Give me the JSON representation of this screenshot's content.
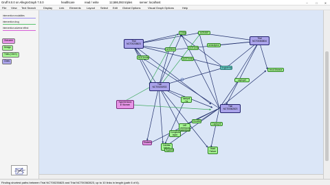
{
  "window": {
    "app_title": "Gruff 8.0.0 on AllegroGraph 7.0.0",
    "repo": "healthcare",
    "mode": "read / write",
    "triples": "12,586,093 triples",
    "server": "server: localhost"
  },
  "window_buttons": [
    "–",
    "□",
    "✕"
  ],
  "menu": [
    "File",
    "View",
    "Text Search",
    "Display",
    "Link",
    "Elements",
    "Layout",
    "Select",
    "Edit",
    "Global Options",
    "Visual Graph Options",
    "Help"
  ],
  "legend": {
    "lines": [
      {
        "label": "intervention modalities",
        "color": "#9b8ff0"
      },
      {
        "label": "intervention drug",
        "color": "#55c26b"
      },
      {
        "label": "intervention adverse effect",
        "color": "#d65bd6"
      }
    ],
    "chips": [
      {
        "label": "Outcome",
        "color": "#e794e7"
      },
      {
        "label": "Design",
        "color": "#a5f592"
      },
      {
        "label": "Trials (ClinG)",
        "color": "#a5f592"
      },
      {
        "label": "Class",
        "color": "#aaa3ea"
      }
    ]
  },
  "graph": {
    "nodes": [
      {
        "label": "Trial\nNCT00235823",
        "type": "purple"
      },
      {
        "label": "Trial\nNCT00363834",
        "type": "purple"
      },
      {
        "label": "Trial\nNCT00234933",
        "type": "purple"
      },
      {
        "label": "Trial\nNCT00362823",
        "type": "purple"
      },
      {
        "label": "C08A",
        "type": "green"
      },
      {
        "label": "ACEA5S",
        "type": "green"
      },
      {
        "label": "ACE5N1",
        "type": "green"
      },
      {
        "label": "ACE1nhib",
        "type": "green"
      },
      {
        "label": "amlodipine",
        "type": "green"
      },
      {
        "label": "Angiotensin",
        "type": "teal"
      },
      {
        "label": "ACE1Inhib",
        "type": "green"
      },
      {
        "label": "ACE7nhib",
        "type": "green"
      },
      {
        "label": "renal disease",
        "type": "green"
      },
      {
        "label": "captopril",
        "type": "green"
      },
      {
        "label": "ramipril / lis",
        "type": "green"
      },
      {
        "label": "Diuretic",
        "type": "green"
      },
      {
        "label": "Left\nventricular\nhypertrophy",
        "type": "green"
      },
      {
        "label": "Captopril",
        "type": "green"
      },
      {
        "label": "Heart\nFailure",
        "type": "green"
      },
      {
        "label": "Cardiac\nfailure",
        "type": "green"
      },
      {
        "label": "Hypertension\nin Women",
        "type": "magenta"
      },
      {
        "label": "Diabetes",
        "type": "magenta"
      },
      {
        "label": "Congestive\nheart\nfailure",
        "type": "green"
      },
      {
        "label": "Hypertension",
        "type": "green"
      }
    ]
  },
  "status": "Finding shortest paths between Trial NCT00235823 and Trial NCT00362823, up to 10 links in length (path 6 of 6)."
}
